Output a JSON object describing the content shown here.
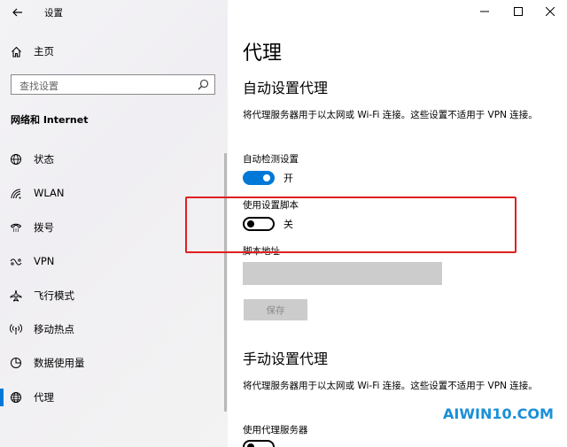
{
  "app": {
    "title": "设置"
  },
  "sidebar": {
    "home_label": "主页",
    "search_placeholder": "查找设置",
    "section_title": "网络和 Internet",
    "items": [
      {
        "label": "状态",
        "icon": "globe-status-icon"
      },
      {
        "label": "WLAN",
        "icon": "wifi-icon"
      },
      {
        "label": "拨号",
        "icon": "dialup-phone-icon"
      },
      {
        "label": "VPN",
        "icon": "vpn-icon"
      },
      {
        "label": "飞行模式",
        "icon": "airplane-icon"
      },
      {
        "label": "移动热点",
        "icon": "hotspot-icon"
      },
      {
        "label": "数据使用量",
        "icon": "data-usage-icon"
      },
      {
        "label": "代理",
        "icon": "globe-icon",
        "active": true
      }
    ]
  },
  "main": {
    "page_title": "代理",
    "auto": {
      "heading": "自动设置代理",
      "description": "将代理服务器用于以太网或 Wi-Fi 连接。这些设置不适用于 VPN 连接。",
      "auto_detect_label": "自动检测设置",
      "auto_detect_state": "开",
      "use_script_label": "使用设置脚本",
      "use_script_state": "关",
      "script_address_label": "脚本地址",
      "save_label": "保存"
    },
    "manual": {
      "heading": "手动设置代理",
      "description": "将代理服务器用于以太网或 Wi-Fi 连接。这些设置不适用于 VPN 连接。",
      "use_proxy_label": "使用代理服务器"
    }
  },
  "watermark": "AIWIN10.COM",
  "colors": {
    "accent": "#0078d7",
    "highlight": "#e02020",
    "watermark": "#1a8fd8"
  }
}
